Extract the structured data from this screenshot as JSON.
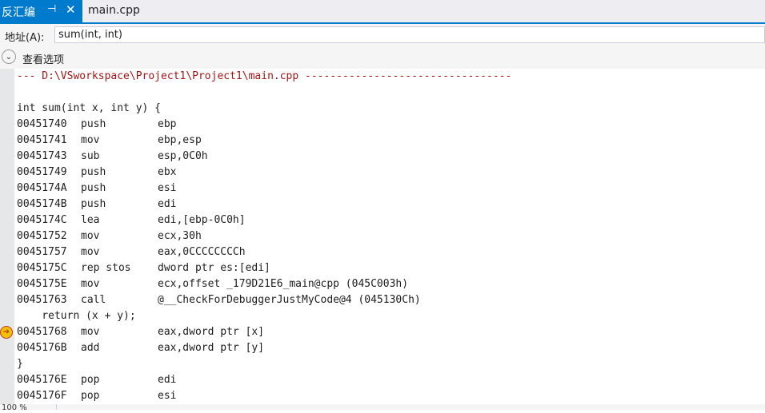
{
  "tabs": {
    "active": {
      "title": "反汇编",
      "pin": "⊣",
      "close": "✕"
    },
    "inactive": {
      "title": "main.cpp"
    }
  },
  "address": {
    "label": "地址(A):",
    "value": "sum(int, int)"
  },
  "view_options": {
    "label": "查看选项"
  },
  "code": {
    "header": "--- D:\\VSworkspace\\Project1\\Project1\\main.cpp ---------------------------------",
    "signature": "int sum(int x, int y) {",
    "block1": [
      {
        "addr": "00451740",
        "mnem": "push",
        "ops": "ebp"
      },
      {
        "addr": "00451741",
        "mnem": "mov",
        "ops": "ebp,esp"
      },
      {
        "addr": "00451743",
        "mnem": "sub",
        "ops": "esp,0C0h"
      },
      {
        "addr": "00451749",
        "mnem": "push",
        "ops": "ebx"
      },
      {
        "addr": "0045174A",
        "mnem": "push",
        "ops": "esi"
      },
      {
        "addr": "0045174B",
        "mnem": "push",
        "ops": "edi"
      },
      {
        "addr": "0045174C",
        "mnem": "lea",
        "ops": "edi,[ebp-0C0h]"
      },
      {
        "addr": "00451752",
        "mnem": "mov",
        "ops": "ecx,30h"
      },
      {
        "addr": "00451757",
        "mnem": "mov",
        "ops": "eax,0CCCCCCCCh"
      },
      {
        "addr": "0045175C",
        "mnem": "rep stos",
        "ops": "dword ptr es:[edi]"
      },
      {
        "addr": "0045175E",
        "mnem": "mov",
        "ops": "ecx,offset _179D21E6_main@cpp (045C003h)"
      },
      {
        "addr": "00451763",
        "mnem": "call",
        "ops": "@__CheckForDebuggerJustMyCode@4 (045130Ch)"
      }
    ],
    "return_line": "    return (x + y);",
    "block2": [
      {
        "addr": "00451768",
        "mnem": "mov",
        "ops": "eax,dword ptr [x]"
      },
      {
        "addr": "0045176B",
        "mnem": "add",
        "ops": "eax,dword ptr [y]"
      }
    ],
    "close_brace": "}",
    "block3": [
      {
        "addr": "0045176E",
        "mnem": "pop",
        "ops": "edi"
      },
      {
        "addr": "0045176F",
        "mnem": "pop",
        "ops": "esi"
      }
    ],
    "arrow_glyph": "➔"
  },
  "status": {
    "zoom": "100 %"
  },
  "colors": {
    "accent": "#007acc",
    "header_text": "#a31515",
    "arrow": "#f2c200"
  }
}
